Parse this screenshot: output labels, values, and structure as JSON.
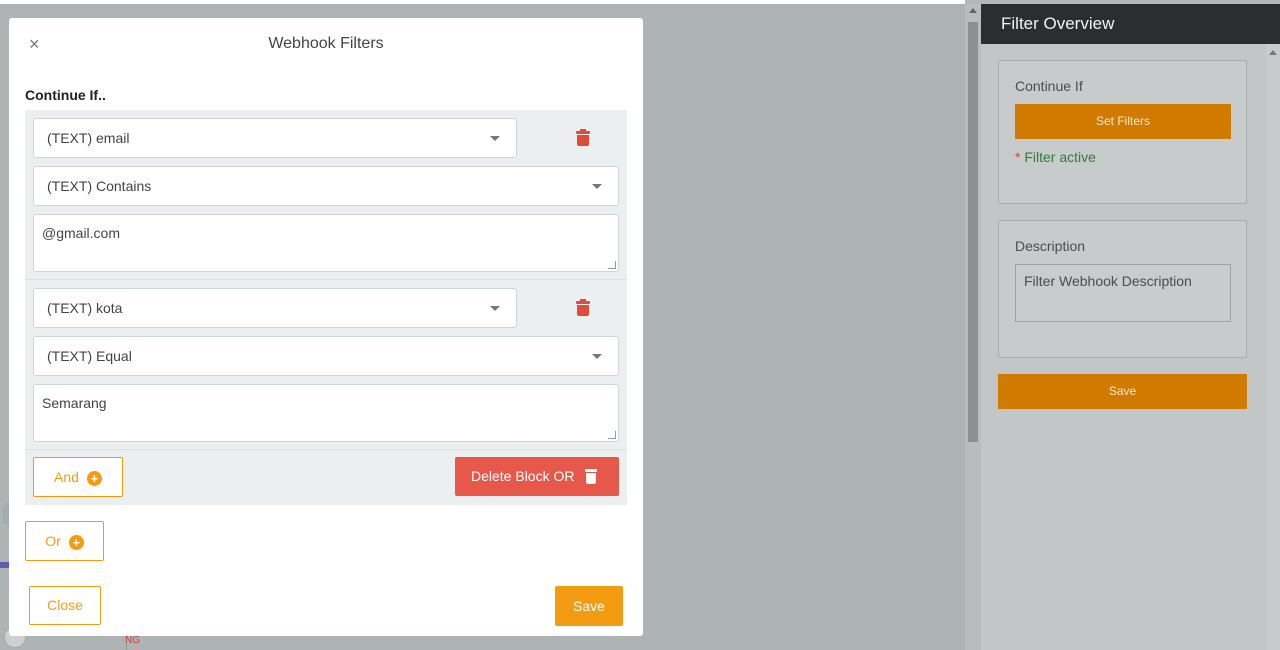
{
  "modal": {
    "title": "Webhook Filters",
    "close_icon": "×",
    "continue_label": "Continue If..",
    "conditions": [
      {
        "field": "(TEXT) email",
        "operator": "(TEXT) Contains",
        "value": "@gmail.com"
      },
      {
        "field": "(TEXT) kota",
        "operator": "(TEXT) Equal",
        "value": "Semarang"
      }
    ],
    "and_label": "And",
    "delete_block_label": "Delete Block OR",
    "or_label": "Or",
    "close_label": "Close",
    "save_label": "Save",
    "plus_glyph": "+"
  },
  "right_panel": {
    "title": "Filter Overview",
    "continue_title": "Continue If",
    "set_filters_label": "Set Filters",
    "filter_active_star": "*",
    "filter_active_label": "Filter active",
    "description_title": "Description",
    "description_value": "Filter Webhook Description",
    "save_label": "Save"
  },
  "background": {
    "fragment_text": "NG"
  },
  "colors": {
    "accent": "#f39c12",
    "accent_dark": "#d17a00",
    "danger": "#e5584a",
    "success": "#2f7d3a",
    "header_dark": "#2b2d2f"
  },
  "icons": [
    "close-icon",
    "chevron-down-icon",
    "trash-icon",
    "plus-circle-icon"
  ]
}
